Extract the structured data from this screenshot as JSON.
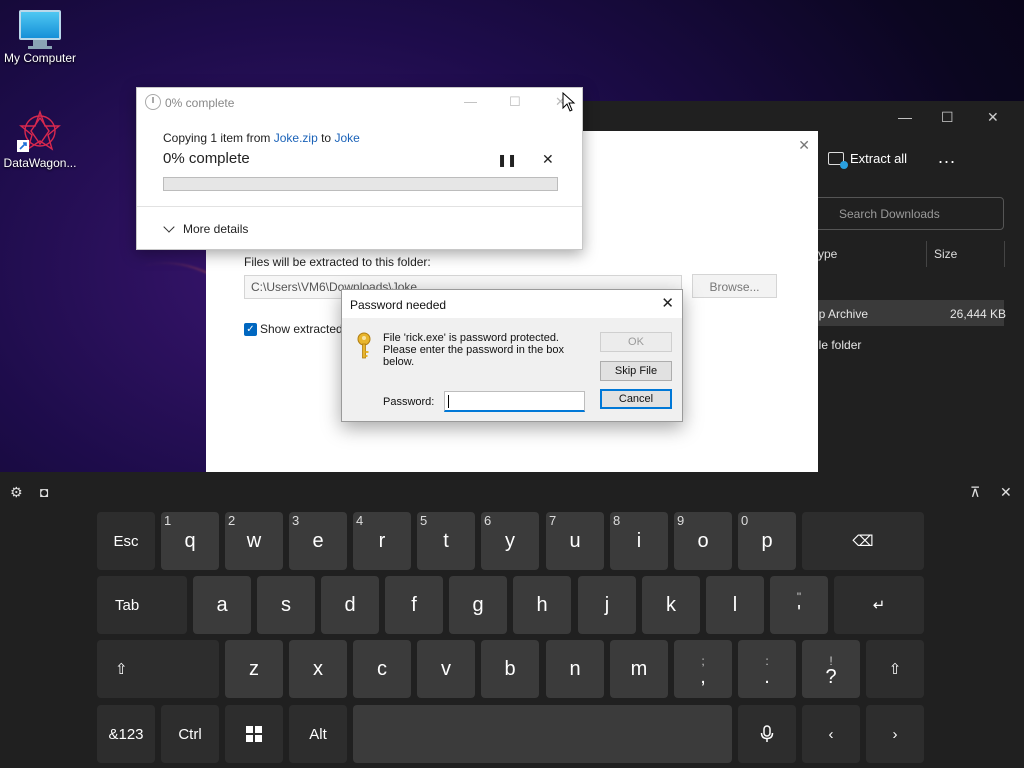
{
  "desktop": {
    "icons": [
      {
        "label": "My Computer",
        "icon": "monitor-icon"
      },
      {
        "label": "DataWagon...",
        "icon": "datawagon-icon"
      }
    ]
  },
  "explorer": {
    "extract_all_label": "Extract all",
    "more_label": "...",
    "search_placeholder": "Search Downloads",
    "columns": {
      "type": "Type",
      "size": "Size"
    },
    "rows": [
      {
        "type": "Zip Archive",
        "size": "26,444 KB",
        "selected": true
      },
      {
        "type": "File folder",
        "size": ""
      }
    ],
    "visible_rows": [
      {
        "type": "ip Archive",
        "size": "26,444 KB"
      },
      {
        "type": "ile folder",
        "size": ""
      }
    ],
    "type_header_visible": "ype"
  },
  "extract_dialog": {
    "label": "Files will be extracted to this folder:",
    "path": "C:\\Users\\VM6\\Downloads\\Joke",
    "browse_label": "Browse...",
    "show_extracted_label": "Show extracted",
    "show_extracted_checked": true
  },
  "copy_progress": {
    "title": "0% complete",
    "line_prefix": "Copying 1 item from ",
    "source": "Joke.zip",
    "line_mid": " to ",
    "dest": "Joke",
    "status": "0% complete",
    "progress": 0,
    "more_details_label": "More details"
  },
  "password_dialog": {
    "title": "Password needed",
    "message": "File 'rick.exe' is password protected. Please enter the password in the box below.",
    "password_label": "Password:",
    "password_value": "",
    "ok_label": "OK",
    "skip_label": "Skip File",
    "cancel_label": "Cancel"
  },
  "keyboard": {
    "row1": [
      {
        "label": "Esc",
        "sub": ""
      },
      {
        "label": "q",
        "sub": "1"
      },
      {
        "label": "w",
        "sub": "2"
      },
      {
        "label": "e",
        "sub": "3"
      },
      {
        "label": "r",
        "sub": "4"
      },
      {
        "label": "t",
        "sub": "5"
      },
      {
        "label": "y",
        "sub": "6"
      },
      {
        "label": "u",
        "sub": "7"
      },
      {
        "label": "i",
        "sub": "8"
      },
      {
        "label": "o",
        "sub": "9"
      },
      {
        "label": "p",
        "sub": "0"
      },
      {
        "label": "⌫",
        "sub": ""
      }
    ],
    "row2": [
      {
        "label": "Tab"
      },
      {
        "label": "a"
      },
      {
        "label": "s"
      },
      {
        "label": "d"
      },
      {
        "label": "f"
      },
      {
        "label": "g"
      },
      {
        "label": "h"
      },
      {
        "label": "j"
      },
      {
        "label": "k"
      },
      {
        "label": "l"
      },
      {
        "label": "'",
        "top": "\""
      },
      {
        "label": "↵"
      }
    ],
    "row3": [
      {
        "label": "⇧"
      },
      {
        "label": "z"
      },
      {
        "label": "x"
      },
      {
        "label": "c"
      },
      {
        "label": "v"
      },
      {
        "label": "b"
      },
      {
        "label": "n"
      },
      {
        "label": "m"
      },
      {
        "label": ",",
        "top": ";"
      },
      {
        "label": ".",
        "top": ":"
      },
      {
        "label": "?",
        "top": "!"
      },
      {
        "label": "⇧"
      }
    ],
    "row4": [
      {
        "label": "&123"
      },
      {
        "label": "Ctrl"
      },
      {
        "label": "⊞"
      },
      {
        "label": "Alt"
      },
      {
        "label": ""
      },
      {
        "label": "🎤"
      },
      {
        "label": "‹"
      },
      {
        "label": "›"
      }
    ]
  }
}
